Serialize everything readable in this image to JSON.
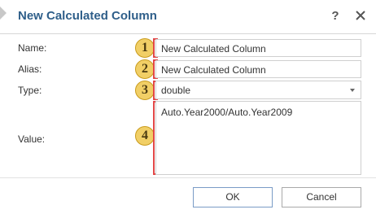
{
  "dialog": {
    "title": "New Calculated Column",
    "help_label": "?",
    "close_icon": "close-icon"
  },
  "form": {
    "name": {
      "label": "Name:",
      "value": "New Calculated Column",
      "callout": "1"
    },
    "alias": {
      "label": "Alias:",
      "value": "New Calculated Column",
      "callout": "2"
    },
    "type": {
      "label": "Type:",
      "value": "double",
      "callout": "3"
    },
    "value": {
      "label": "Value:",
      "value": "Auto.Year2000/Auto.Year2009",
      "callout": "4"
    }
  },
  "buttons": {
    "ok": "OK",
    "cancel": "Cancel"
  },
  "colors": {
    "title": "#2f5f8a",
    "callout_fill": "#f1cf66",
    "bracket": "#e24848"
  }
}
